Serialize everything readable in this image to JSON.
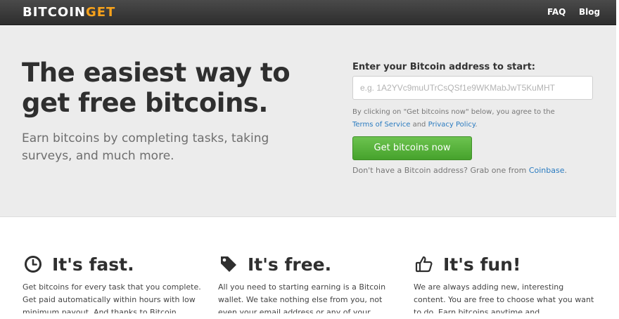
{
  "navbar": {
    "logo_main": "BITCOIN",
    "logo_accent": "GET",
    "links": [
      {
        "label": "FAQ"
      },
      {
        "label": "Blog"
      }
    ]
  },
  "hero": {
    "title": "The easiest way to get free bitcoins.",
    "subtitle": "Earn bitcoins by completing tasks, taking surveys, and much more.",
    "form": {
      "label": "Enter your Bitcoin address to start:",
      "placeholder": "e.g. 1A2YVc9muUTrCsQSf1e9WKMabJwT5KuMHT",
      "value": "",
      "terms_prefix": "By clicking on \"Get bitcoins now\" below, you agree to the",
      "terms_link": "Terms of Service",
      "terms_and": "and",
      "privacy_link": "Privacy Policy",
      "terms_end": ".",
      "button_label": "Get bitcoins now",
      "no_address_text": "Don't have a Bitcoin address? Grab one from",
      "coinbase_link": "Coinbase",
      "no_address_end": "."
    }
  },
  "features": [
    {
      "icon": "clock-icon",
      "title": "It's fast.",
      "text": "Get bitcoins for every task that you complete. Get paid automatically within hours with low minimum payout. And thanks to Bitcoin"
    },
    {
      "icon": "tag-icon",
      "title": "It's free.",
      "text": "All you need to starting earning is a Bitcoin wallet. We take nothing else from you, not even your email address or any of your"
    },
    {
      "icon": "thumbs-up-icon",
      "title": "It's fun!",
      "text": "We are always adding new, interesting content. You are free to choose what you want to do. Earn bitcoins anytime and"
    }
  ],
  "colors": {
    "navbar": "#2d2d2d",
    "logo_accent": "#f7a21b",
    "hero_bg": "#ececec",
    "cta_green": "#4eab34",
    "link_blue": "#2a7bc0"
  }
}
